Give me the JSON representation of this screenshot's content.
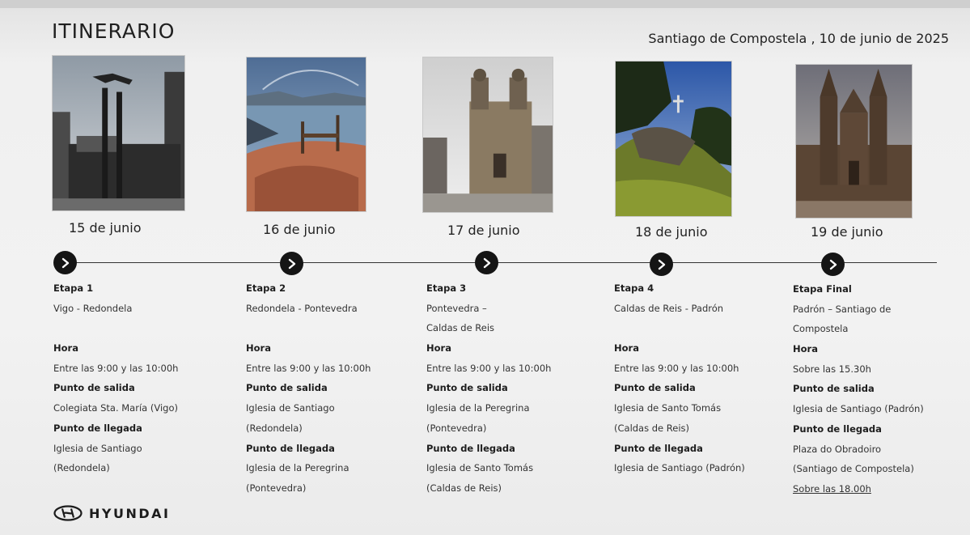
{
  "header": {
    "title": "ITINERARIO",
    "subtitle": "Santiago de Compostela , 10 de junio de 2025"
  },
  "stages": [
    {
      "date": "15 de junio",
      "photo": "Vigo monument sculpture",
      "etapa": "Etapa 1",
      "route": [
        "Vigo - Redondela"
      ],
      "hora_label": "Hora",
      "hora": "Entre las 9:00 y las 10:00h",
      "salida_label": "Punto de salida",
      "salida": [
        "Colegiata Sta. María (Vigo)"
      ],
      "llegada_label": "Punto de llegada",
      "llegada": [
        "Iglesia de Santiago",
        "(Redondela)"
      ]
    },
    {
      "date": "16 de junio",
      "photo": "Coastal viewpoint with bench",
      "etapa": "Etapa 2",
      "route": [
        "Redondela - Pontevedra"
      ],
      "hora_label": "Hora",
      "hora": "Entre las 9:00 y las 10:00h",
      "salida_label": "Punto de salida",
      "salida": [
        "Iglesia de Santiago",
        "(Redondela)"
      ],
      "llegada_label": "Punto de llegada",
      "llegada": [
        "Iglesia de la Peregrina",
        "(Pontevedra)"
      ]
    },
    {
      "date": "17 de junio",
      "photo": "Iglesia de la Peregrina",
      "etapa": "Etapa 3",
      "route": [
        "Pontevedra –",
        "Caldas de Reis"
      ],
      "hora_label": "Hora",
      "hora": "Entre las 9:00 y las 10:00h",
      "salida_label": "Punto de salida",
      "salida": [
        "Iglesia de la Peregrina",
        "(Pontevedra)"
      ],
      "llegada_label": "Punto de llegada",
      "llegada": [
        "Iglesia de Santo Tomás",
        "(Caldas de Reis)"
      ]
    },
    {
      "date": "18 de junio",
      "photo": "Green hill with stone cross",
      "etapa": "Etapa 4",
      "route": [
        "Caldas de Reis - Padrón"
      ],
      "hora_label": "Hora",
      "hora": "Entre las 9:00 y las 10:00h",
      "salida_label": "Punto de salida",
      "salida": [
        "Iglesia de Santo Tomás",
        "(Caldas de Reis)"
      ],
      "llegada_label": "Punto de llegada",
      "llegada": [
        "Iglesia de Santiago (Padrón)"
      ]
    },
    {
      "date": "19 de junio",
      "photo": "Catedral de Santiago de Compostela",
      "etapa": "Etapa Final",
      "route": [
        "Padrón – Santiago de",
        "Compostela"
      ],
      "hora_label": "Hora",
      "hora": "Sobre las 15.30h",
      "salida_label": "Punto de salida",
      "salida": [
        "Iglesia de Santiago (Padrón)"
      ],
      "llegada_label": "Punto de llegada",
      "llegada": [
        "Plaza do Obradoiro",
        "(Santiago de Compostela)"
      ],
      "extra": "Sobre las 18.00h"
    }
  ],
  "footer": {
    "brand": "HYUNDAI"
  }
}
